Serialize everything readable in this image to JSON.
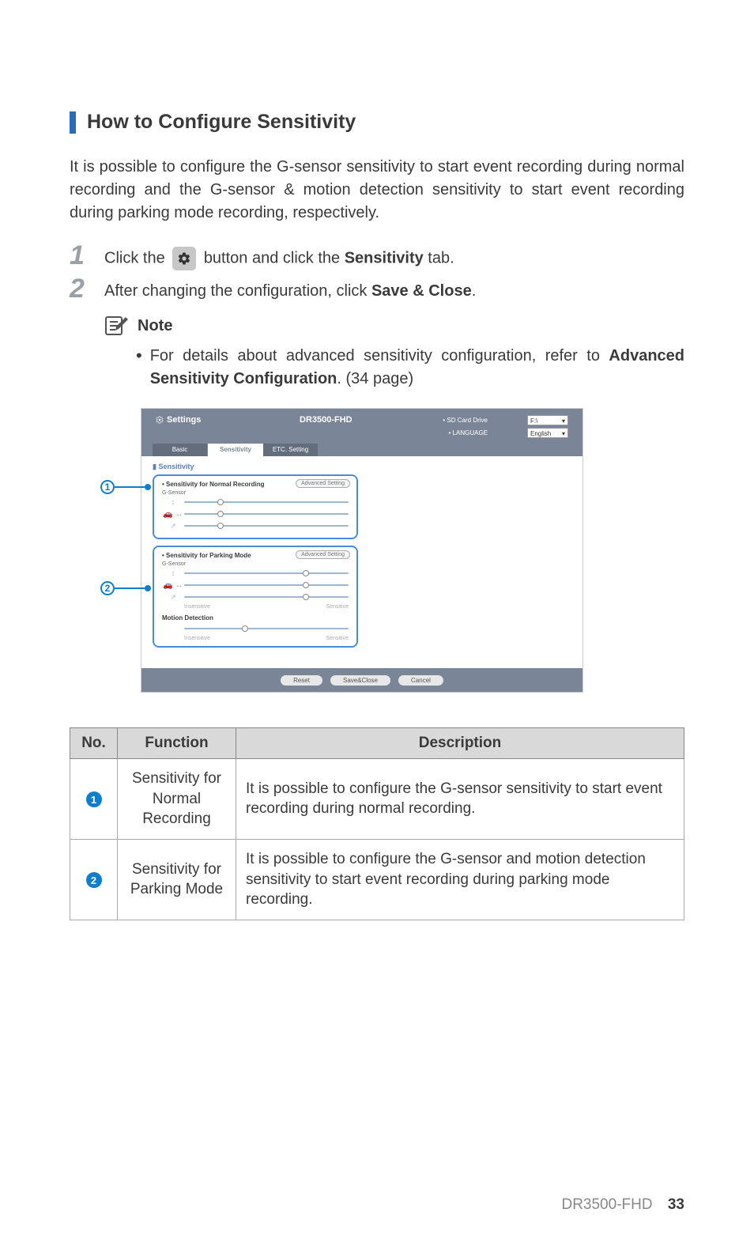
{
  "section_title": "How to Configure Sensitivity",
  "intro": "It is possible to configure the G-sensor sensitivity to start event recording during normal recording and the G-sensor & motion detection sensitivity to start event recording during parking mode recording, respectively.",
  "step1_a": "Click the ",
  "step1_b": " button and click the ",
  "step1_bold": "Sensitivity",
  "step1_c": " tab.",
  "step2_a": "After changing the configuration, click ",
  "step2_bold": "Save & Close",
  "step2_c": ".",
  "note_title": "Note",
  "note_a": "For details about advanced sensitivity configuration, refer to ",
  "note_bold": "Advanced Sensitivity Configuration",
  "note_c": ". (34 page)",
  "ss": {
    "settings": "Settings",
    "title": "DR3500-FHD",
    "sd": "• SD Card Drive",
    "lang": "• LANGUAGE",
    "drive": "F:\\",
    "english": "English",
    "tab_basic": "Basic",
    "tab_sens": "Sensitivity",
    "tab_etc": "ETC. Setting",
    "sens_hdr": "Sensitivity",
    "normal_title": "• Sensitivity for Normal Recording",
    "parking_title": "• Sensitivity for Parking Mode",
    "gsensor": "G-Sensor",
    "adv": "Advanced Setting",
    "motion": "Motion Detection",
    "insensitive": "Insensitive",
    "sensitive": "Sensitive",
    "reset": "Reset",
    "save": "Save&Close",
    "cancel": "Cancel"
  },
  "table": {
    "h_no": "No.",
    "h_fn": "Function",
    "h_desc": "Description",
    "r1_fn": "Sensitivity for Normal Recording",
    "r1_desc": "It is possible to configure the G-sensor sensitivity to start event recording during normal recording.",
    "r2_fn": "Sensitivity for Parking Mode",
    "r2_desc": "It is possible to configure the G-sensor and motion detection sensitivity to start event recording during parking mode recording."
  },
  "footer_model": "DR3500-FHD",
  "footer_page": "33"
}
